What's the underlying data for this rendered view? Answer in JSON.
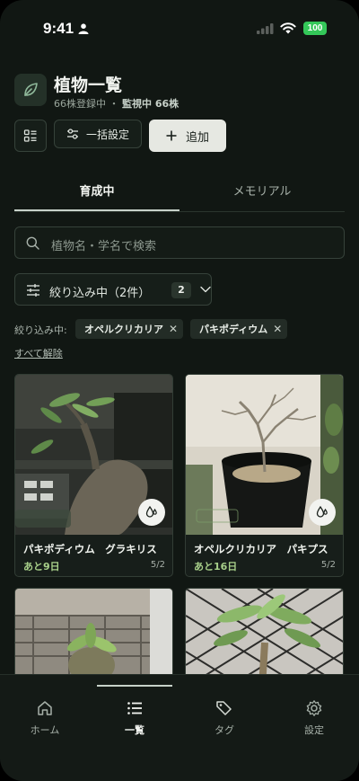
{
  "status_bar": {
    "time": "9:41",
    "battery": "100"
  },
  "header": {
    "title": "植物一覧",
    "registered": "66株登録中",
    "separator": "・",
    "monitoring": "監視中 66株"
  },
  "toolbar": {
    "bulk_label": "一括設定",
    "add_label": "追加"
  },
  "tabs": [
    {
      "label": "育成中",
      "active": true
    },
    {
      "label": "メモリアル",
      "active": false
    }
  ],
  "search": {
    "placeholder": "植物名・学名で検索"
  },
  "filter": {
    "label": "絞り込み中（2件）",
    "count": "2",
    "active_label": "絞り込み中:",
    "chips": [
      "オペルクリカリア",
      "パキポディウム"
    ],
    "clear_all": "すべて解除"
  },
  "plants": [
    {
      "name": "パキポディウム　グラキリス",
      "due": "あと9日",
      "date": "5/2"
    },
    {
      "name": "オペルクリカリア　パキプス",
      "due": "あと16日",
      "date": "5/2"
    }
  ],
  "bottom_nav": [
    {
      "label": "ホーム",
      "icon": "home-icon"
    },
    {
      "label": "一覧",
      "icon": "list-icon",
      "active": true
    },
    {
      "label": "タグ",
      "icon": "tags-icon"
    },
    {
      "label": "設定",
      "icon": "gear-icon"
    }
  ],
  "colors": {
    "background": "#111713",
    "accent_due": "#a8d08a",
    "battery": "#34c759"
  }
}
